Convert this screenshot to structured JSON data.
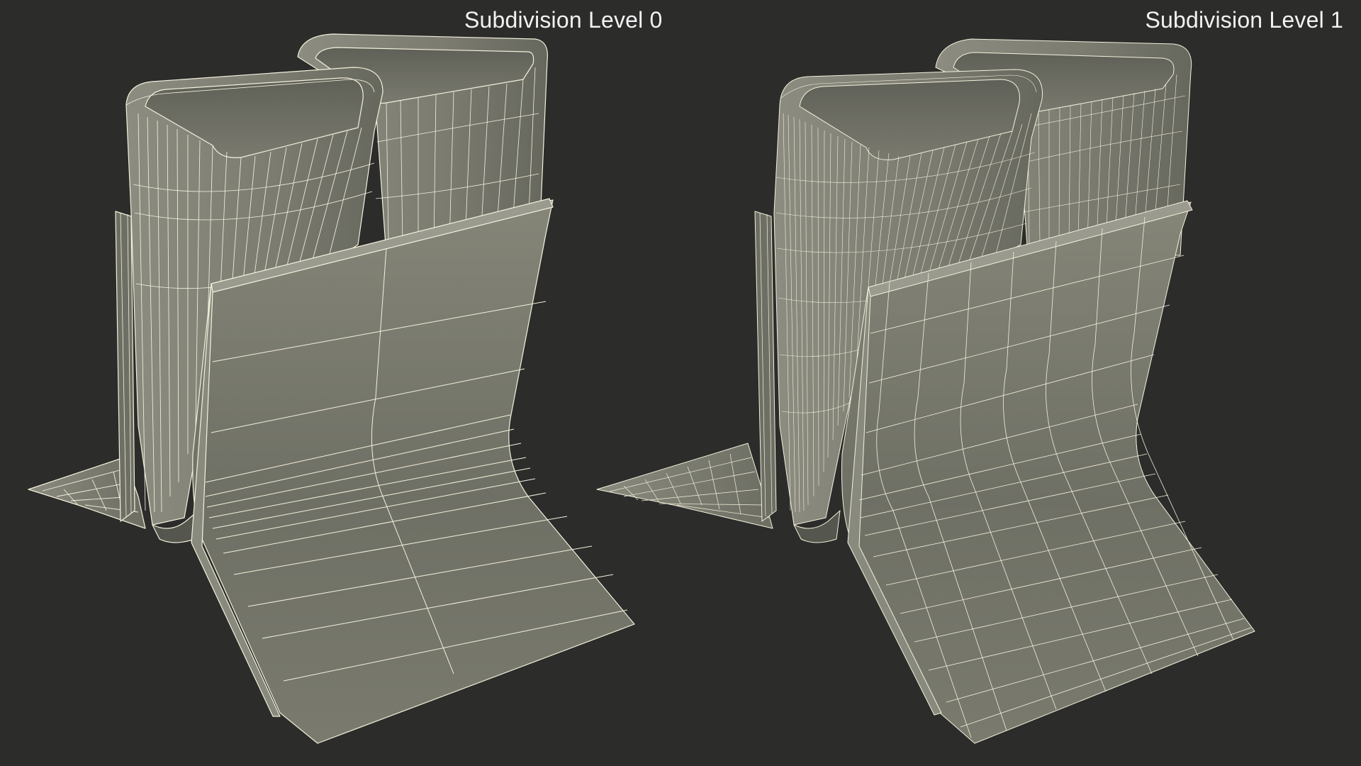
{
  "labels": {
    "left": "Subdivision Level 0",
    "right": "Subdivision Level 1"
  },
  "colors": {
    "background": "#2c2c2b",
    "surface": "#7d7d72",
    "surface_dark": "#5b5c53",
    "surface_light": "#95958a",
    "wire": "#f4f1dc"
  }
}
